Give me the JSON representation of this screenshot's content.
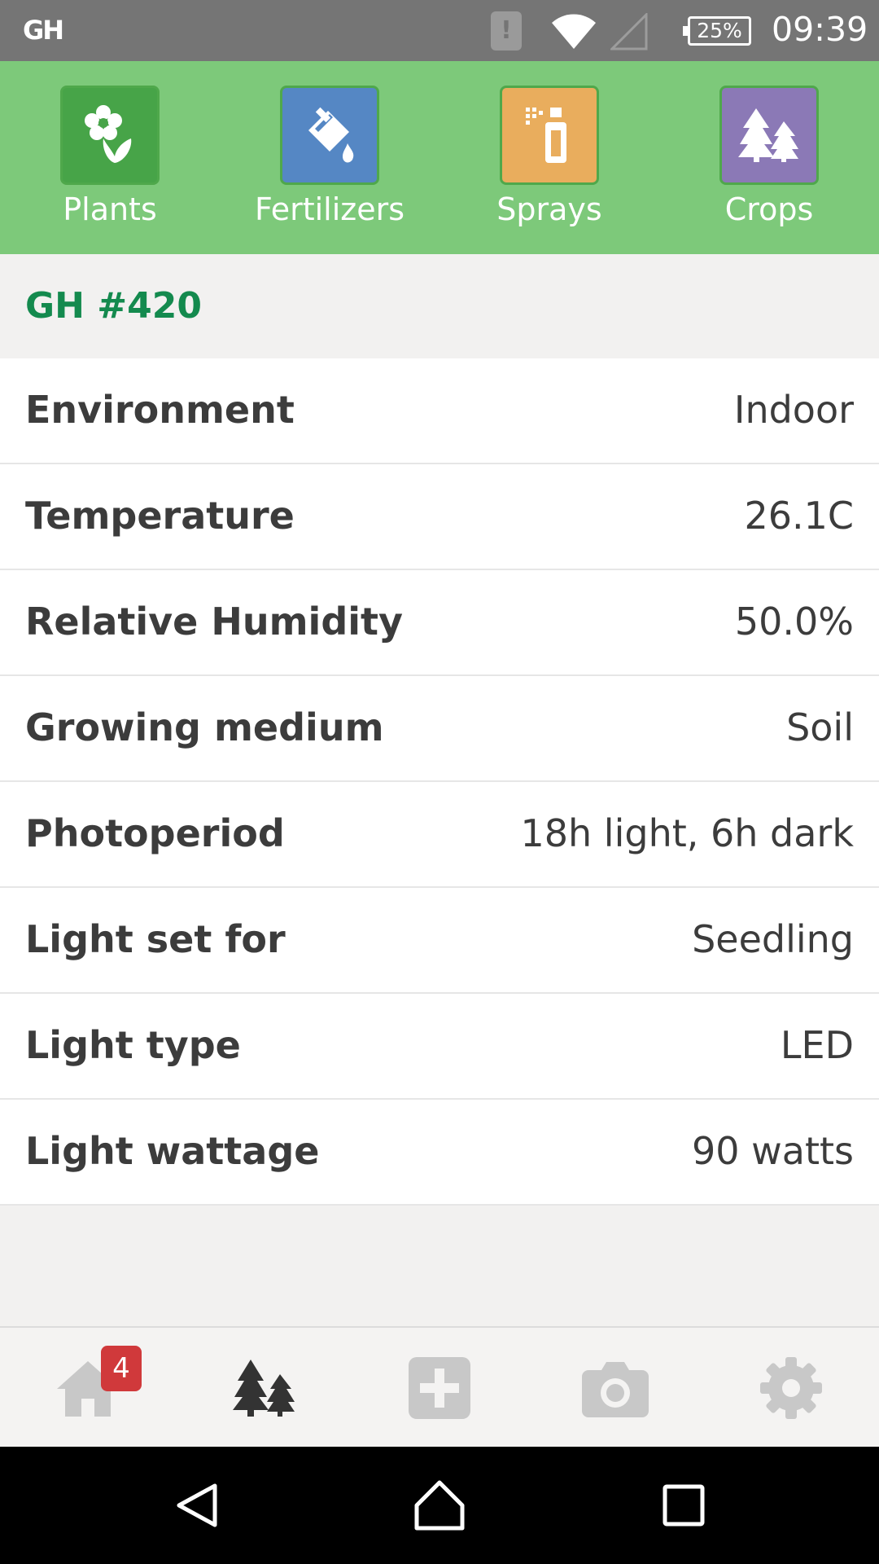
{
  "status_bar": {
    "logo": "GH",
    "battery": "25%",
    "time": "09:39",
    "icons": [
      "alert-icon",
      "wifi-icon",
      "signal-icon",
      "battery-icon"
    ]
  },
  "top_nav": {
    "items": [
      {
        "label": "Plants",
        "icon": "flower-icon",
        "color": "#47a448"
      },
      {
        "label": "Fertilizers",
        "icon": "paint-bucket-icon",
        "color": "#5587c4"
      },
      {
        "label": "Sprays",
        "icon": "spray-bottle-icon",
        "color": "#e9ad5d"
      },
      {
        "label": "Crops",
        "icon": "trees-icon",
        "color": "#8b79b6"
      }
    ]
  },
  "greenhouse": {
    "title": "GH #420",
    "details": [
      {
        "key": "Environment",
        "value": "Indoor"
      },
      {
        "key": "Temperature",
        "value": "26.1C"
      },
      {
        "key": "Relative Humidity",
        "value": "50.0%"
      },
      {
        "key": "Growing medium",
        "value": "Soil"
      },
      {
        "key": "Photoperiod",
        "value": "18h light, 6h dark"
      },
      {
        "key": "Light set for",
        "value": "Seedling"
      },
      {
        "key": "Light type",
        "value": "LED"
      },
      {
        "key": "Light wattage",
        "value": "90 watts"
      }
    ]
  },
  "tab_bar": {
    "badge": "4",
    "tabs": [
      "home-icon",
      "trees-icon",
      "plus-icon",
      "camera-icon",
      "gear-icon"
    ],
    "active": "trees-icon"
  },
  "colors": {
    "accent_green": "#7dc97a",
    "title_green": "#148a4e",
    "badge_red": "#d0393b"
  }
}
